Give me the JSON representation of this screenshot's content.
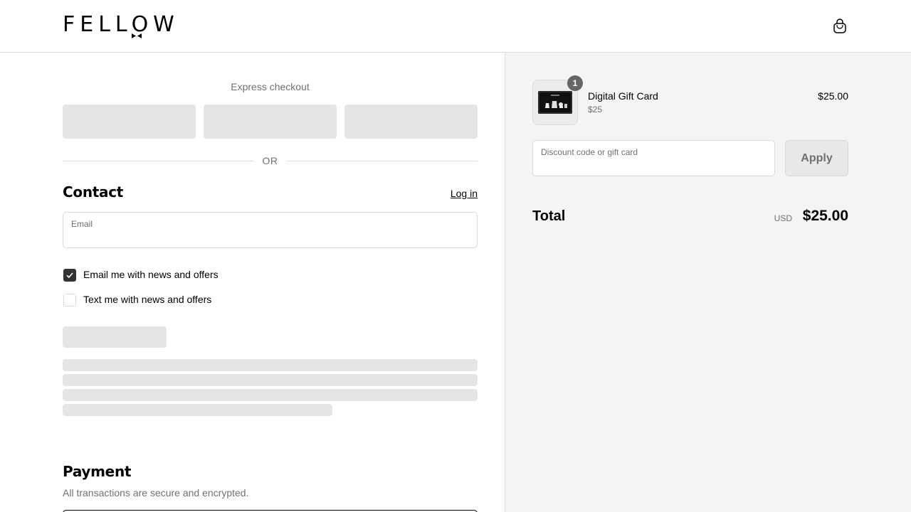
{
  "header": {
    "logo_text": "FELLOW",
    "cart_icon": "shopping-bag-icon"
  },
  "express": {
    "title": "Express checkout",
    "divider_text": "OR",
    "buttons_loading": 3
  },
  "contact": {
    "heading": "Contact",
    "login_link": "Log in",
    "email_label": "Email",
    "email_value": "",
    "checkboxes": [
      {
        "label": "Email me with news and offers",
        "checked": true
      },
      {
        "label": "Text me with news and offers",
        "checked": false
      }
    ]
  },
  "payment": {
    "heading": "Payment",
    "subtitle": "All transactions are secure and encrypted."
  },
  "order": {
    "item": {
      "name": "Digital Gift Card",
      "variant": "$25",
      "price": "$25.00",
      "quantity": "1"
    },
    "discount": {
      "label": "Discount code or gift card",
      "value": "",
      "apply_label": "Apply"
    },
    "total": {
      "label": "Total",
      "currency": "USD",
      "amount": "$25.00"
    }
  },
  "colors": {
    "accent_checkbox": "#333333",
    "summary_background": "#f4f4f4",
    "skeleton": "#e5e5e5",
    "muted_text": "#707070"
  }
}
